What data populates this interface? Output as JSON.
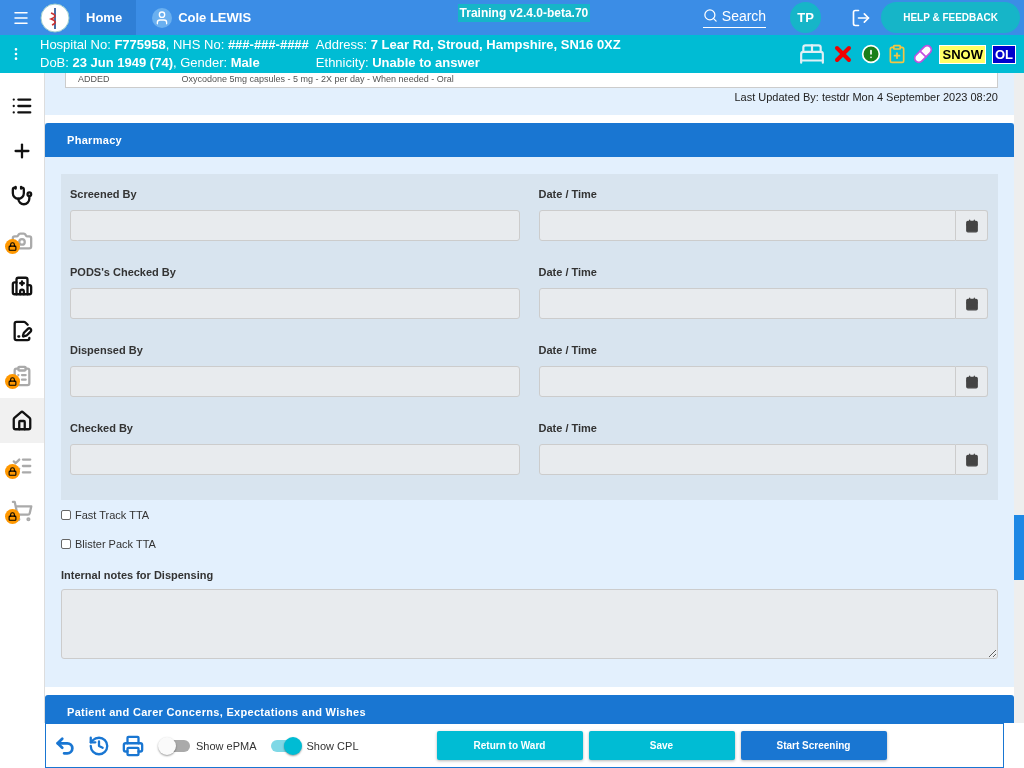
{
  "app_bar": {
    "breadcrumbs": [
      {
        "label": "Home"
      },
      {
        "label": "Cole LEWIS"
      }
    ],
    "environment": "Training v2.4.0-beta.70",
    "search_label": "Search",
    "user_initials": "TP",
    "help_button": "HELP & FEEDBACK"
  },
  "patient_banner": {
    "details": [
      "Hospital No: **F775958**, NHS No: **###-###-####**",
      "Address: **7 Lear Rd, Stroud, Hampshire, SN16 0XZ**",
      "DoB: **23 Jun 1949 (74)**, Gender: **Male**",
      "Ethnicity: **Unable to answer**"
    ],
    "badges": [
      {
        "label": "SNOW",
        "kind": "warning"
      },
      {
        "label": "OL",
        "kind": "info"
      }
    ]
  },
  "sidebar": {
    "items": [
      {
        "locked": false,
        "selected": false
      },
      {
        "locked": false,
        "selected": false
      },
      {
        "locked": false,
        "selected": false
      },
      {
        "locked": true,
        "selected": false
      },
      {
        "locked": false,
        "selected": false
      },
      {
        "locked": false,
        "selected": false
      },
      {
        "locked": true,
        "selected": false
      },
      {
        "locked": false,
        "selected": true
      },
      {
        "locked": true,
        "selected": false
      },
      {
        "locked": true,
        "selected": false
      }
    ]
  },
  "medication_row": {
    "status": "ADDED",
    "description": "Oxycodone 5mg capsules - 5 mg - 2X per day - When needed - Oral"
  },
  "last_updated": "Last Updated By: testdr Mon 4 September 2023 08:20",
  "pharmacy": {
    "title": "Pharmacy",
    "rows": [
      {
        "name_label": "Screened By",
        "date_label": "Date / Time"
      },
      {
        "name_label": "PODS's Checked By",
        "date_label": "Date / Time"
      },
      {
        "name_label": "Dispensed By",
        "date_label": "Date / Time"
      },
      {
        "name_label": "Checked By",
        "date_label": "Date / Time"
      }
    ],
    "options": [
      {
        "label": "Fast Track TTA",
        "checked": false
      },
      {
        "label": "Blister Pack TTA",
        "checked": false
      }
    ],
    "notes_label": "Internal notes for Dispensing"
  },
  "next_section": {
    "title": "Patient and Carer Concerns, Expectations and Wishes"
  },
  "footer": {
    "toggles": [
      {
        "label": "Show ePMA",
        "on": false
      },
      {
        "label": "Show CPL",
        "on": true
      }
    ],
    "buttons": [
      {
        "label": "Return to Ward",
        "kind": "secondary"
      },
      {
        "label": "Save",
        "kind": "secondary"
      },
      {
        "label": "Start Screening",
        "kind": "primary"
      }
    ]
  }
}
